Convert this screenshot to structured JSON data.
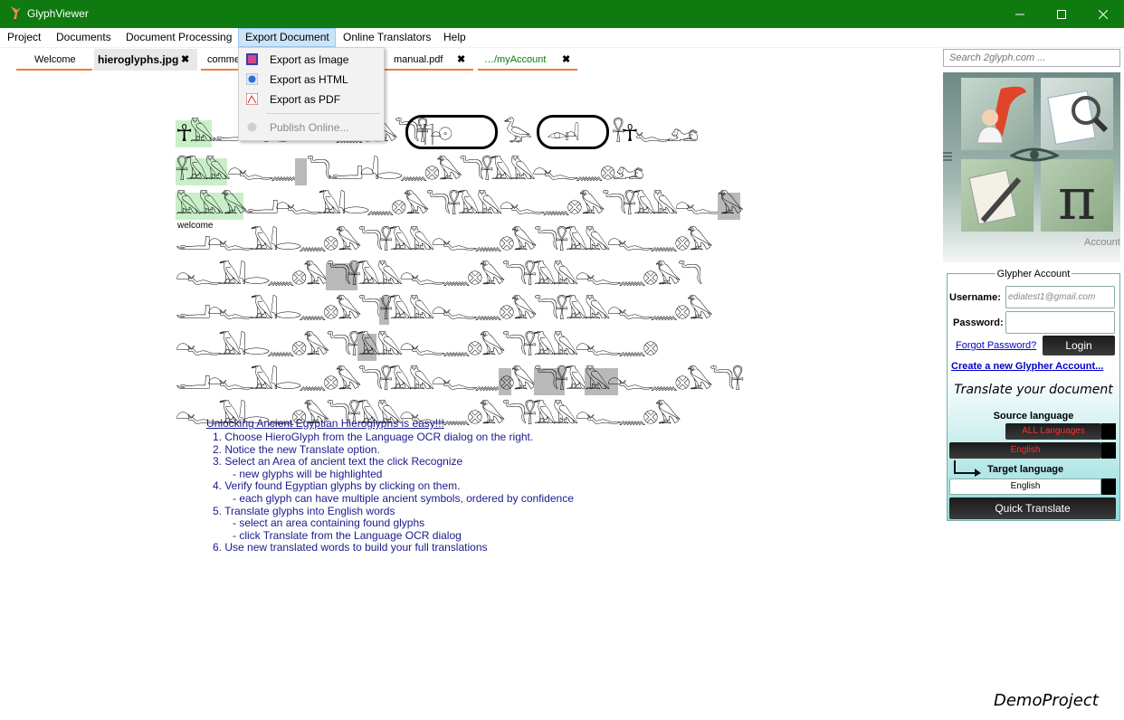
{
  "window": {
    "title": "GlyphViewer",
    "colors": {
      "titlebar": "#0f7a0f",
      "tab_underline": "#f07a3a",
      "instruction_text": "#1a1a8c"
    }
  },
  "menu": {
    "items": [
      "Project",
      "Documents",
      "Document Processing",
      "Export Document",
      "Online Translators",
      "Help"
    ],
    "active": "Export Document"
  },
  "tabs": [
    {
      "label": "Welcome",
      "closable": false
    },
    {
      "label": "hieroglyphs.jpg",
      "closable": true,
      "active": true
    },
    {
      "label": "comme",
      "closable": false
    },
    {
      "label": "manual.pdf",
      "closable": true
    },
    {
      "label": "…/myAccount",
      "closable": true
    }
  ],
  "export_menu": {
    "items": [
      {
        "label": "Export as Image",
        "icon": "image-icon",
        "enabled": true
      },
      {
        "label": "Export as HTML",
        "icon": "html-icon",
        "enabled": true
      },
      {
        "label": "Export as PDF",
        "icon": "pdf-icon",
        "enabled": true
      },
      {
        "label": "Publish Online...",
        "icon": "publish-icon",
        "enabled": false
      }
    ]
  },
  "document": {
    "welcome_label": "welcome",
    "heading": "Unlocking Ancient Egyptian Hieroglyphs is easy!!!",
    "steps": [
      "1. Choose HieroGlyph from the Language OCR dialog on the right.",
      "2. Notice the new Translate option.",
      "3. Select an Area of ancient text the click Recognize",
      "- new glyphs will be highlighted",
      "4. Verify found Egyptian glyphs by clicking on them.",
      "- each glyph can have multiple ancient symbols, ordered by confidence",
      "5. Translate glyphs into English words",
      "- select an area containing found glyphs",
      "- click Translate from the Language OCR dialog",
      "6. Use new translated words to build your full translations"
    ]
  },
  "sidebar": {
    "search_placeholder": "Search 2glyph.com ...",
    "tiles": [
      "account-icon",
      "search-document-icon",
      "edit-document-icon",
      "pi-icon"
    ],
    "account_link": "Account"
  },
  "account": {
    "title": "Glypher Account",
    "username_label": "Username:",
    "username_value": "ediatest1@gmail.com",
    "password_label": "Password:",
    "forgot_link": "Forgot Password?",
    "login_button": "Login",
    "create_link": "Create a new Glypher Account...",
    "translate_heading": "Translate your document",
    "source_label": "Source language",
    "source_options": [
      "ALL Languages",
      "English"
    ],
    "target_label": "Target language",
    "target_value": "English",
    "quick_translate": "Quick Translate"
  },
  "footer": {
    "project_name": "DemoProject"
  }
}
